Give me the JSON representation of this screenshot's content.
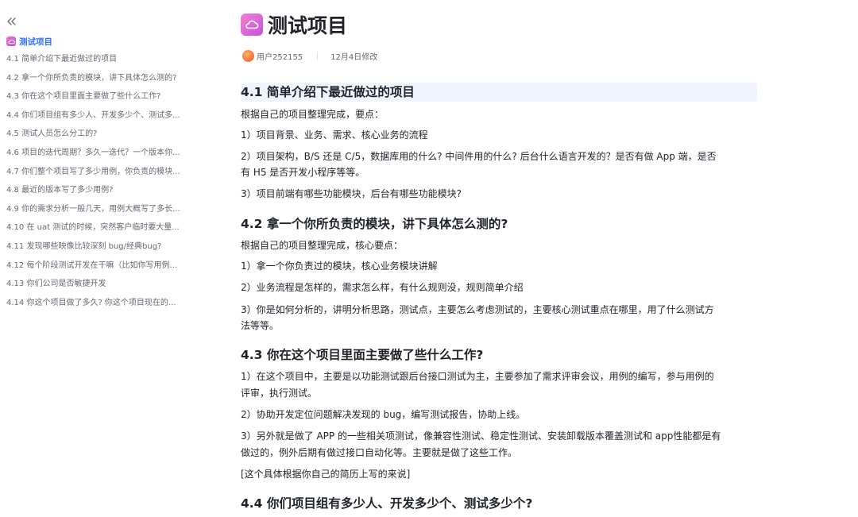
{
  "sidebar": {
    "collapse_icon": "double-chevron-left-icon",
    "doc_icon": "cloud-icon",
    "root_label": "测试项目",
    "accent_color": "#3370ff",
    "items": [
      {
        "label": "4.1 简单介绍下最近做过的项目"
      },
      {
        "label": "4.2 拿一个你所负责的模块，讲下具体怎么测的?"
      },
      {
        "label": "4.3 你在这个项目里面主要做了些什么工作?"
      },
      {
        "label": "4.4 你们项目组有多少人、开发多少个、测试多..."
      },
      {
        "label": "4.5 测试人员怎么分工的?"
      },
      {
        "label": "4.6 项目的迭代周期？多久一迭代？一个版本你..."
      },
      {
        "label": "4.7 你们整个项目写了多少用例，你负责的模块..."
      },
      {
        "label": "4.8 最近的版本写了多少用例?"
      },
      {
        "label": "4.9 你的需求分析一般几天，用例大概写了多长..."
      },
      {
        "label": "4.10 在 uat 测试的时候，突然客户临时要大量..."
      },
      {
        "label": "4.11 发现哪些映像比较深刻 bug/经典bug?"
      },
      {
        "label": "4.12 每个阶段测试开发在干嘛（比如你写用例..."
      },
      {
        "label": "4.13 你们公司是否敏捷开发"
      },
      {
        "label": "4.14 你这个项目做了多久? 你这个项目现在的..."
      }
    ]
  },
  "header": {
    "title": "测试项目",
    "author": "用户252155",
    "modified": "12月4日修改"
  },
  "content": {
    "s1": {
      "heading": "4.1 简单介绍下最近做过的项目",
      "p1": "根据自己的项目整理完成，要点：",
      "p2": "1）项目背景、业务、需求、核心业务的流程",
      "p3a": "2）项目架构，B/S 还是 C/5，数据库用的什么? 中间件用的什么? 后台什么语言开发的？是否有做 App 端，是否",
      "p3b": "有 H5 是否开发小程序等等。",
      "p4": "3）项目前端有哪些功能模块，后台有哪些功能模块?"
    },
    "s2": {
      "heading": "4.2 拿一个你所负责的模块，讲下具体怎么测的?",
      "p1": "根据自己的项目整理完成，核心要点：",
      "p2": "1）拿一个你负责过的模块，核心业务模块讲解",
      "p3": "2）业务流程是怎样的，需求怎么样，有什么规则没，规则简单介绍",
      "p4a": "3）你是如何分析的，讲明分析思路，测试点，主要怎么考虑测试的，主要核心测试重点在哪里，用了什么测试方",
      "p4b": "法等等。"
    },
    "s3": {
      "heading": "4.3 你在这个项目里面主要做了些什么工作?",
      "p1a": "1）在这个项目中，主要是以功能测试跟后台接口测试为主，主要参加了需求评审会议，用例的编写，参与用例的",
      "p1b": "评审，执行测试。",
      "p2": "2）协助开发定位问题解决发现的 bug，编写测试报告，协助上线。",
      "p3a": "3）另外就是做了 APP 的一些相关项测试，像兼容性测试、稳定性测试、安装卸载版本覆盖测试和 app性能都是有",
      "p3b": "做过的，例外后期有做过接口自动化等。主要就是做了这些工作。",
      "p4": "[这个具体根据你自己的简历上写的来说]"
    },
    "s4": {
      "heading": "4.4 你们项目组有多少人、开发多少个、测试多少个?"
    }
  }
}
